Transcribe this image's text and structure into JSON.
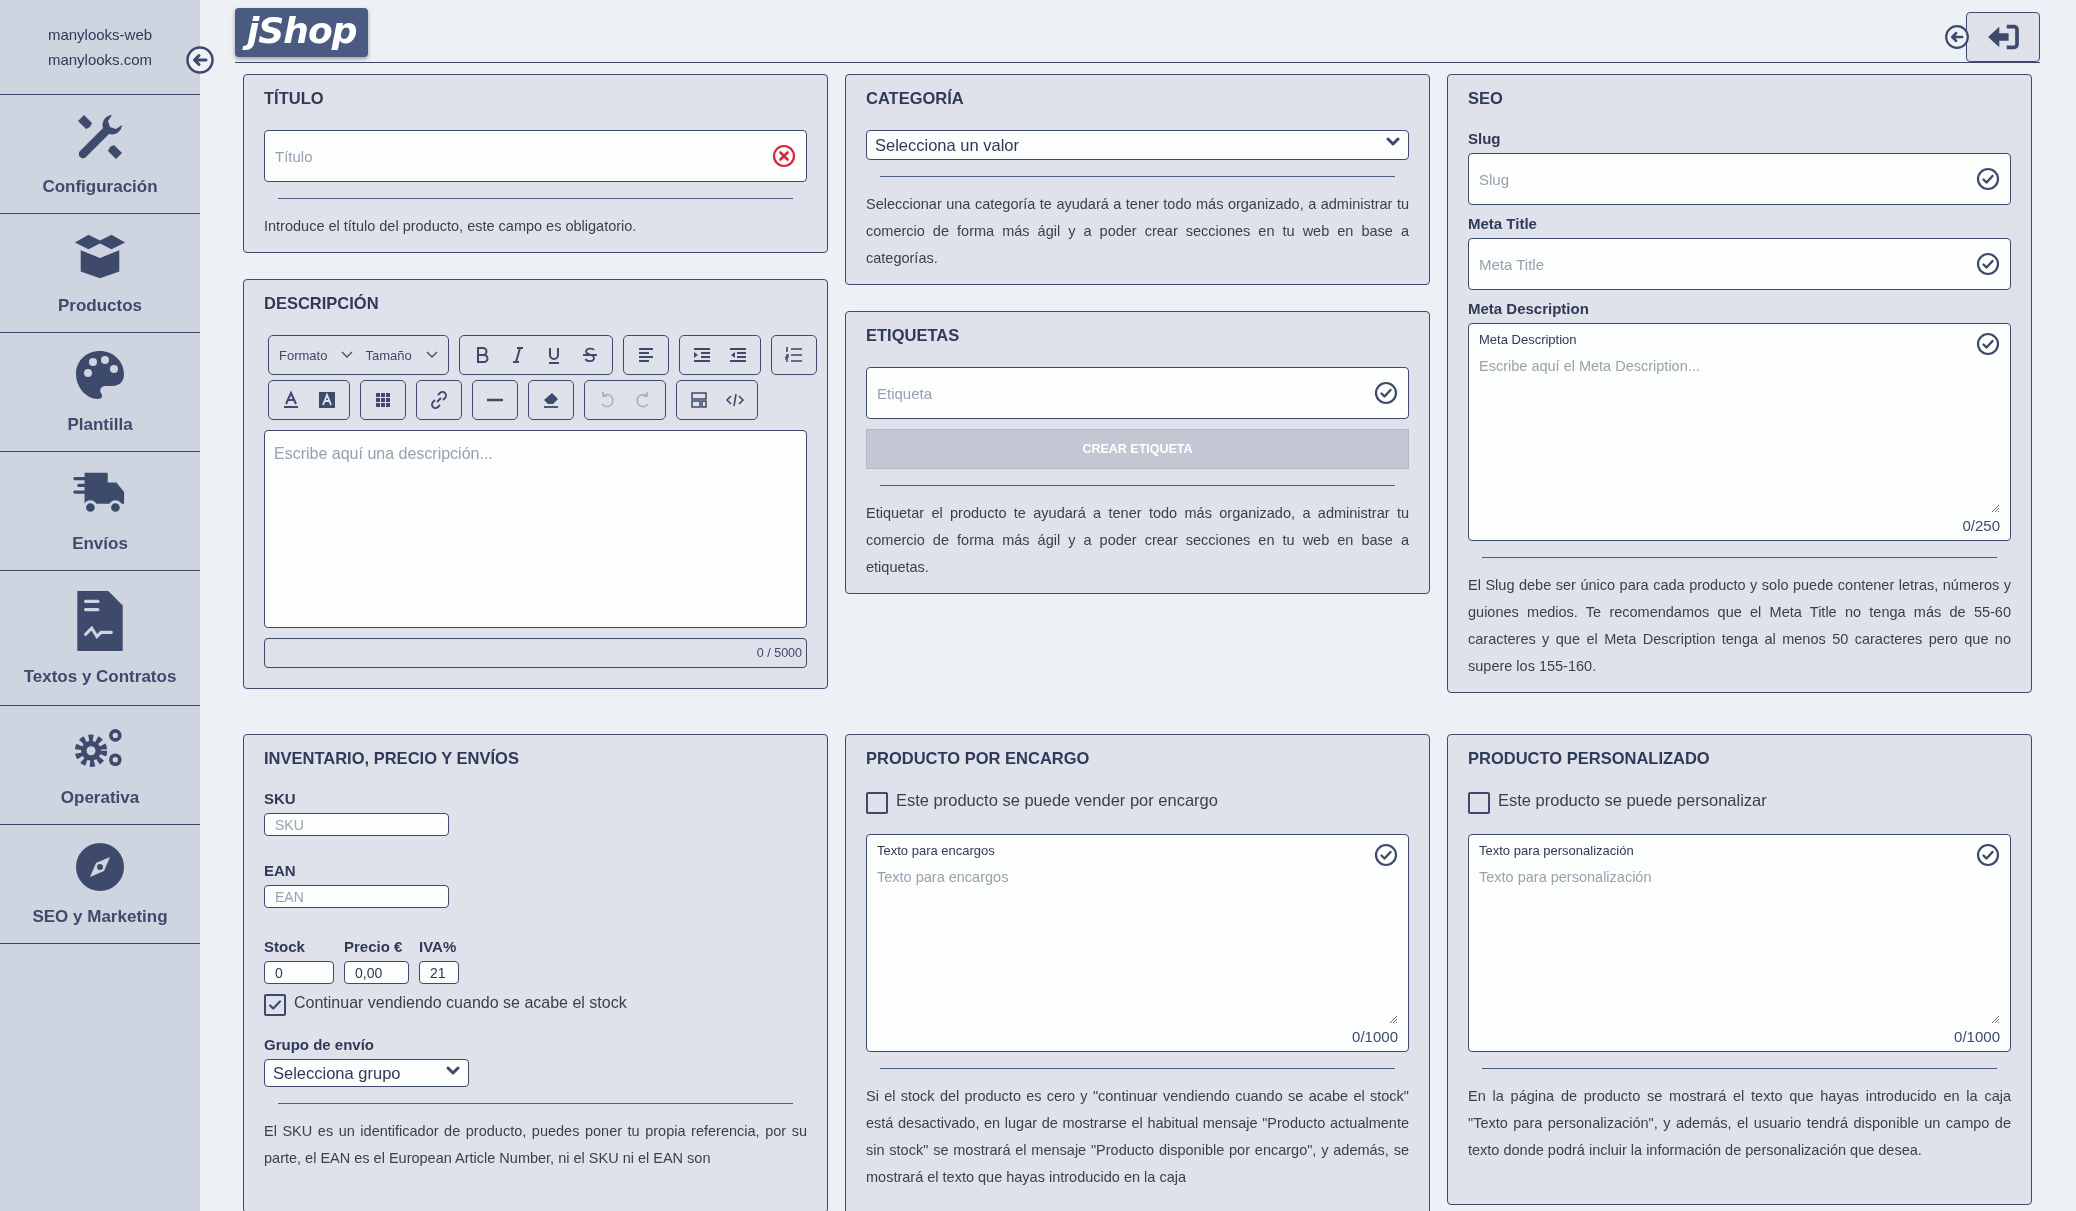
{
  "sidebar": {
    "account": [
      "manylooks-web",
      "manylooks.com"
    ],
    "items": [
      {
        "label": "Configuración"
      },
      {
        "label": "Productos"
      },
      {
        "label": "Plantilla"
      },
      {
        "label": "Envíos"
      },
      {
        "label": "Textos y Contratos"
      },
      {
        "label": "Operativa"
      },
      {
        "label": "SEO y Marketing"
      }
    ]
  },
  "header": {
    "logo": "jShop"
  },
  "title_panel": {
    "heading": "TÍTULO",
    "field": {
      "placeholder": "Título",
      "valid": false
    },
    "help": "Introduce el título del producto, este campo es obligatorio."
  },
  "description_panel": {
    "heading": "DESCRIPCIÓN",
    "toolbar": {
      "format": "Formato",
      "size": "Tamaño",
      "history_disabled": true
    },
    "editor": {
      "placeholder": "Escribe aquí una descripción..."
    },
    "counter": "0 / 5000"
  },
  "category_panel": {
    "heading": "CATEGORÍA",
    "select": {
      "value": "Selecciona un valor"
    },
    "help": "Seleccionar una categoría te ayudará a tener todo más organizado, a administrar tu comercio de forma más ágil y a poder crear secciones en tu web en base a categorías."
  },
  "tags_panel": {
    "heading": "ETIQUETAS",
    "field": {
      "placeholder": "Etiqueta",
      "valid": true
    },
    "button": {
      "label": "CREAR ETIQUETA",
      "disabled": true
    },
    "help": "Etiquetar el producto te ayudará a tener todo más organizado, a administrar tu comercio de forma más ágil y a poder crear secciones en tu web en base a etiquetas."
  },
  "seo_panel": {
    "heading": "SEO",
    "fields": [
      {
        "label": "Slug",
        "placeholder": "Slug",
        "valid": true
      },
      {
        "label": "Meta Title",
        "placeholder": "Meta Title",
        "valid": true
      }
    ],
    "textarea": {
      "label": "Meta Description",
      "inner_label": "Meta Description",
      "placeholder": "Escribe aquí el Meta Description...",
      "valid": true,
      "counter": "0/250"
    },
    "help": "El Slug debe ser único para cada producto y solo puede contener letras, números y guiones medios. Te recomendamos que el Meta Title no tenga más de 55-60 caracteres y que el Meta Description tenga al menos 50 caracteres pero que no supere los 155-160."
  },
  "inventory_panel": {
    "heading": "INVENTARIO, PRECIO Y ENVÍOS",
    "sku": {
      "label": "SKU",
      "placeholder": "SKU"
    },
    "ean": {
      "label": "EAN",
      "placeholder": "EAN"
    },
    "numbers": [
      {
        "label": "Stock",
        "value": "0"
      },
      {
        "label": "Precio €",
        "value": "0,00"
      },
      {
        "label": "IVA%",
        "value": "21"
      }
    ],
    "continue_selling": {
      "label": "Continuar vendiendo cuando se acabe el stock",
      "checked": true
    },
    "shipping_group": {
      "label": "Grupo de envío",
      "value": "Selecciona grupo"
    },
    "help": "El SKU es un identificador de producto, puedes poner tu propia referencia, por su parte, el EAN es el European Article Number, ni el SKU ni el EAN son"
  },
  "order_panel": {
    "heading": "PRODUCTO POR ENCARGO",
    "checkbox": {
      "label": "Este producto se puede vender por encargo",
      "checked": false
    },
    "textarea": {
      "inner_label": "Texto para encargos",
      "placeholder": "Texto para encargos",
      "valid": true,
      "counter": "0/1000"
    },
    "help": "Si el stock del producto es cero y \"continuar vendiendo cuando se acabe el stock\" está desactivado, en lugar de mostrarse el habitual mensaje \"Producto actualmente sin stock\" se mostrará el mensaje \"Producto disponible por encargo\", y además, se mostrará el texto que hayas introducido en la caja"
  },
  "custom_panel": {
    "heading": "PRODUCTO PERSONALIZADO",
    "checkbox": {
      "label": "Este producto se puede personalizar",
      "checked": false
    },
    "textarea": {
      "inner_label": "Texto para personalización",
      "placeholder": "Texto para personalización",
      "valid": true,
      "counter": "0/1000"
    },
    "help": "En la página de producto se mostrará el texto que hayas introducido en la caja \"Texto para personalización\", y además, el usuario tendrá disponible un campo de texto donde podrá incluir la información de personalización que desea."
  }
}
